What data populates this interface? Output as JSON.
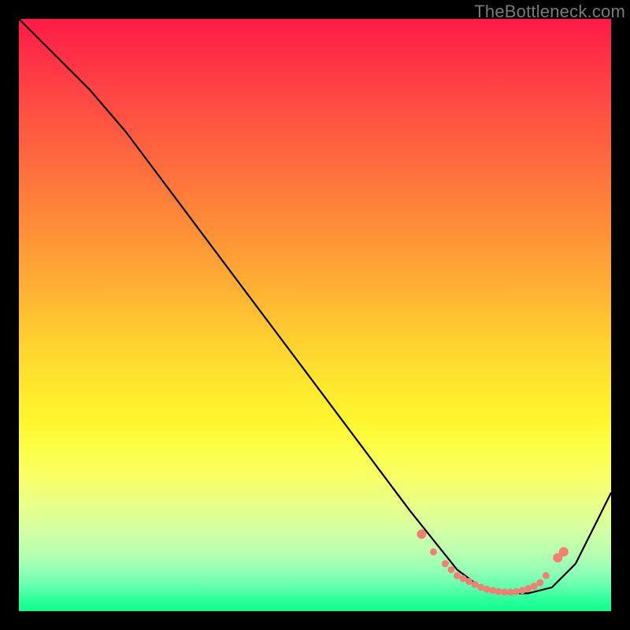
{
  "watermark": "TheBottleneck.com",
  "colors": {
    "frame": "#000000",
    "curve": "#000000",
    "dot": "#f08072",
    "watermark": "#7a7a7a"
  },
  "chart_data": {
    "type": "line",
    "title": "",
    "xlabel": "",
    "ylabel": "",
    "xlim": [
      0,
      100
    ],
    "ylim": [
      0,
      100
    ],
    "grid": false,
    "legend": false,
    "series": [
      {
        "name": "bottleneck-curve",
        "x": [
          0,
          4,
          8,
          12,
          18,
          24,
          30,
          36,
          42,
          48,
          54,
          60,
          66,
          70,
          74,
          78,
          82,
          86,
          90,
          94,
          98,
          100
        ],
        "y": [
          100,
          96,
          92,
          88,
          81,
          73,
          65,
          57,
          49,
          41,
          33,
          25,
          17,
          12,
          7,
          4,
          3,
          3,
          4,
          8,
          16,
          20
        ]
      }
    ],
    "dots": {
      "name": "highlight-dots",
      "x": [
        68,
        70,
        72,
        73,
        74,
        75,
        76,
        77,
        78,
        79,
        80,
        81,
        82,
        83,
        84,
        85,
        86,
        87,
        88,
        89,
        91,
        92
      ],
      "y": [
        13,
        10,
        8,
        7,
        6,
        5.5,
        5,
        4.5,
        4,
        3.7,
        3.5,
        3.3,
        3.2,
        3.2,
        3.3,
        3.5,
        3.8,
        4.2,
        4.8,
        6,
        9,
        10
      ]
    }
  }
}
